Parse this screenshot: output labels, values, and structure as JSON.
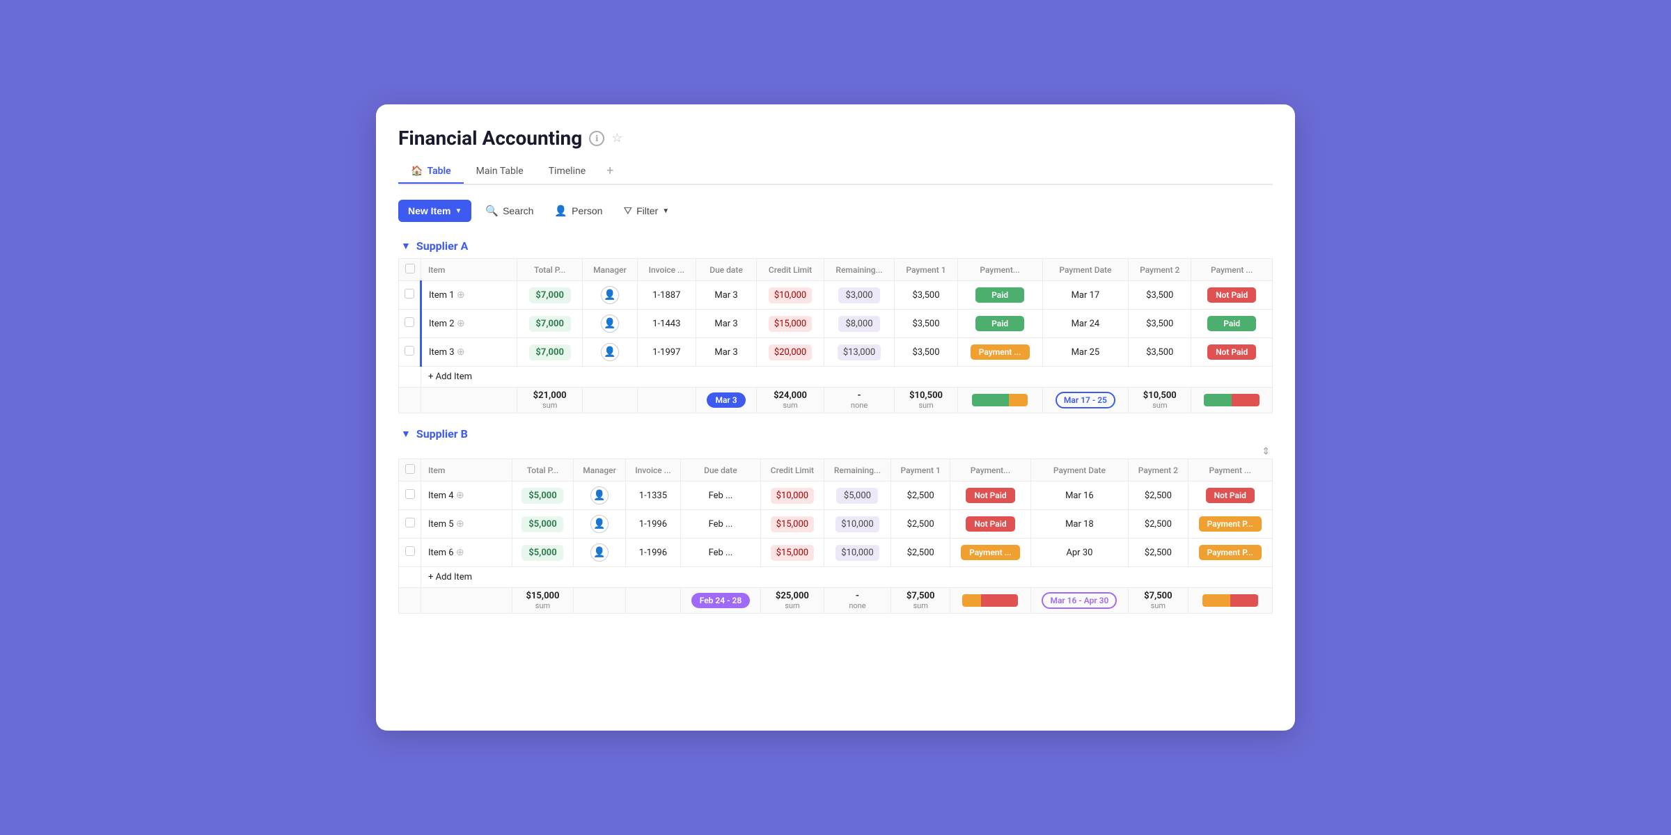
{
  "page": {
    "title": "Financial Accounting",
    "tabs": [
      {
        "label": "Table",
        "icon": "🏠",
        "active": true
      },
      {
        "label": "Main Table",
        "active": false
      },
      {
        "label": "Timeline",
        "active": false
      }
    ],
    "toolbar": {
      "new_item_label": "New Item",
      "search_label": "Search",
      "person_label": "Person",
      "filter_label": "Filter"
    }
  },
  "columns": [
    "Item",
    "Total P...",
    "Manager",
    "Invoice ...",
    "Due date",
    "Credit Limit",
    "Remaining...",
    "Payment 1",
    "Payment...",
    "Payment Date",
    "Payment 2",
    "Payment ..."
  ],
  "suppliers": [
    {
      "name": "Supplier A",
      "items": [
        {
          "id": "Item 1",
          "total": "$7,000",
          "invoice": "1-1887",
          "due": "Mar 3",
          "credit": "$10,000",
          "remaining": "$3,000",
          "pay1": "$3,500",
          "pay1status": "Paid",
          "paydate": "Mar 17",
          "pay2": "$3,500",
          "pay2status": "Not Paid"
        },
        {
          "id": "Item 2",
          "total": "$7,000",
          "invoice": "1-1443",
          "due": "Mar 3",
          "credit": "$15,000",
          "remaining": "$8,000",
          "pay1": "$3,500",
          "pay1status": "Paid",
          "paydate": "Mar 24",
          "pay2": "$3,500",
          "pay2status": "Paid"
        },
        {
          "id": "Item 3",
          "total": "$7,000",
          "invoice": "1-1997",
          "due": "Mar 3",
          "credit": "$20,000",
          "remaining": "$13,000",
          "pay1": "$3,500",
          "pay1status": "Payment ...",
          "paydate": "Mar 25",
          "pay2": "$3,500",
          "pay2status": "Not Paid"
        }
      ],
      "summary": {
        "total": "$21,000",
        "due": "Mar 3",
        "credit": "$24,000",
        "remaining": "-\nnone",
        "pay1": "$10,500",
        "paydate": "Mar 17 - 25",
        "pay2": "$10,500",
        "bars": [
          {
            "color": "green",
            "flex": 2
          },
          {
            "color": "orange",
            "flex": 1
          }
        ],
        "bars2": [
          {
            "color": "green",
            "flex": 1
          },
          {
            "color": "red",
            "flex": 1
          }
        ]
      }
    },
    {
      "name": "Supplier B",
      "items": [
        {
          "id": "Item 4",
          "total": "$5,000",
          "invoice": "1-1335",
          "due": "Feb ...",
          "credit": "$10,000",
          "remaining": "$5,000",
          "pay1": "$2,500",
          "pay1status": "Not Paid",
          "paydate": "Mar 16",
          "pay2": "$2,500",
          "pay2status": "Not Paid"
        },
        {
          "id": "Item 5",
          "total": "$5,000",
          "invoice": "1-1996",
          "due": "Feb ...",
          "credit": "$15,000",
          "remaining": "$10,000",
          "pay1": "$2,500",
          "pay1status": "Not Paid",
          "paydate": "Mar 18",
          "pay2": "$2,500",
          "pay2status": "Payment P..."
        },
        {
          "id": "Item 6",
          "total": "$5,000",
          "invoice": "1-1996",
          "due": "Feb ...",
          "credit": "$15,000",
          "remaining": "$10,000",
          "pay1": "$2,500",
          "pay1status": "Payment ...",
          "paydate": "Apr 30",
          "pay2": "$2,500",
          "pay2status": "Payment P..."
        }
      ],
      "summary": {
        "total": "$15,000",
        "due": "Feb 24 - 28",
        "credit": "$25,000",
        "remaining": "-\nnone",
        "pay1": "$7,500",
        "paydate": "Mar 16 - Apr 30",
        "pay2": "$7,500"
      }
    }
  ]
}
